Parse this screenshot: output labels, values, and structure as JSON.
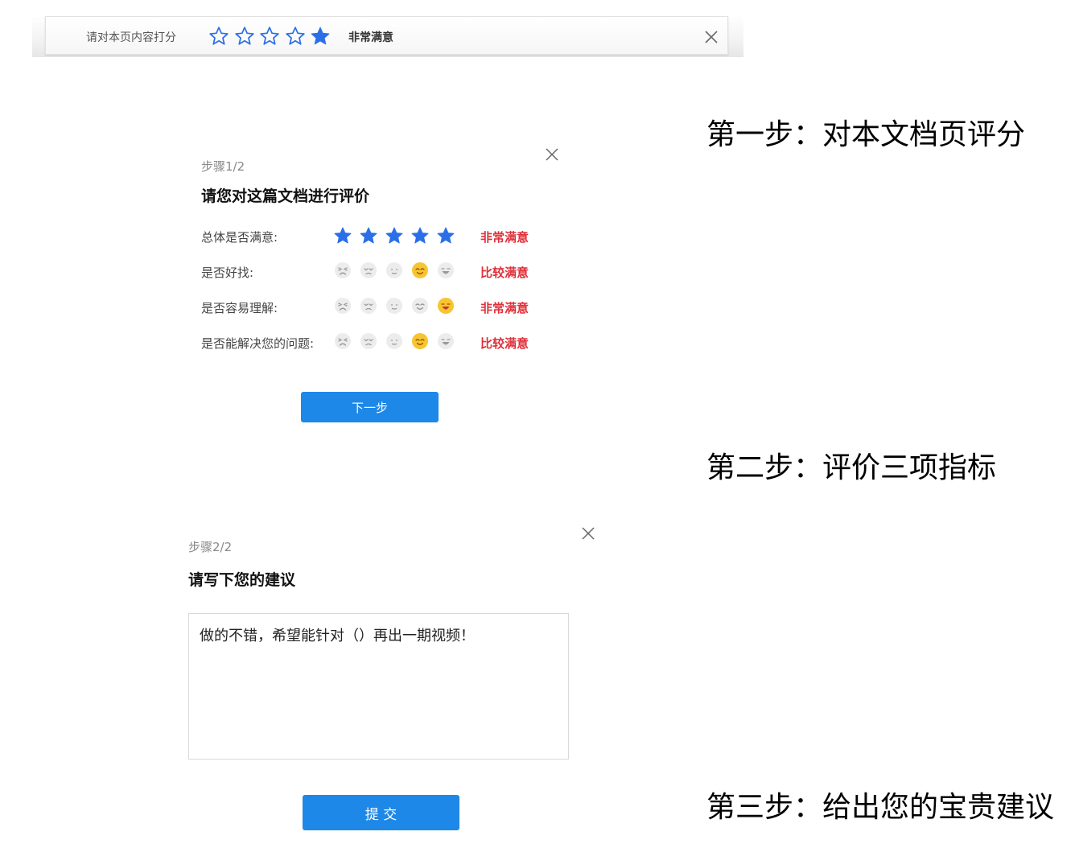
{
  "top_bar": {
    "prompt": "请对本页内容打分",
    "rating_text": "非常满意",
    "star_icons": [
      "star-outline-icon",
      "star-outline-icon",
      "star-outline-icon",
      "star-outline-icon",
      "star-filled-icon"
    ],
    "accent_color": "#2b6fe8"
  },
  "captions": {
    "step1": "第一步：对本文档页评分",
    "step2": "第二步：评价三项指标",
    "step3": "第三步：给出您的宝贵建议"
  },
  "step1": {
    "step_label": "步骤1/2",
    "title": "请您对这篇文档进行评价",
    "rows": [
      {
        "label": "总体是否满意:",
        "type": "stars",
        "rating": 5,
        "status": "非常满意"
      },
      {
        "label": "是否好找:",
        "type": "faces",
        "rating": 4,
        "status": "比较满意"
      },
      {
        "label": "是否容易理解:",
        "type": "faces",
        "rating": 5,
        "status": "非常满意"
      },
      {
        "label": "是否能解决您的问题:",
        "type": "faces",
        "rating": 4,
        "status": "比较满意"
      }
    ],
    "next_button": "下一步",
    "button_color": "#1e88e8",
    "status_color": "#e0303a"
  },
  "step2": {
    "step_label": "步骤2/2",
    "title": "请写下您的建议",
    "suggestion_text": "做的不错，希望能针对（）再出一期视频！",
    "submit_button": "提 交"
  }
}
